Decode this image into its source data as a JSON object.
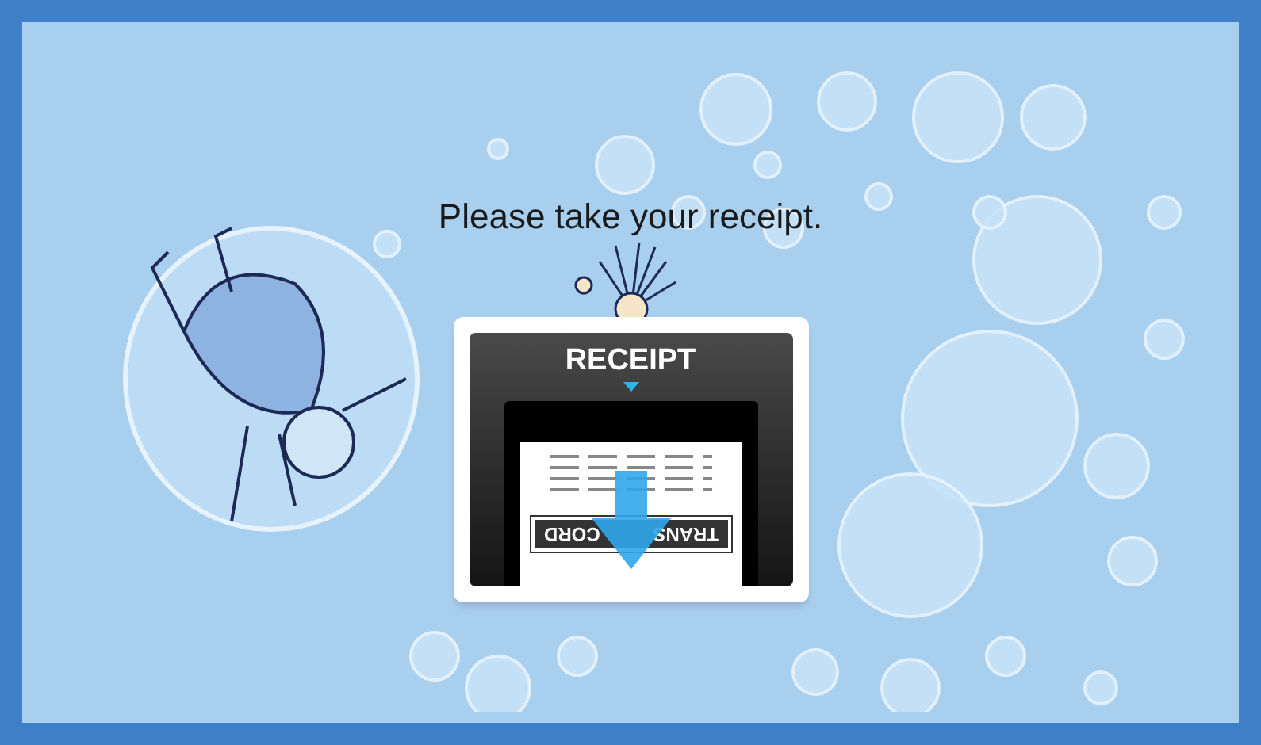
{
  "prompt": "Please take your receipt.",
  "card": {
    "label": "RECEIPT",
    "slip_labels": [
      "TRANS",
      "CORD"
    ]
  }
}
